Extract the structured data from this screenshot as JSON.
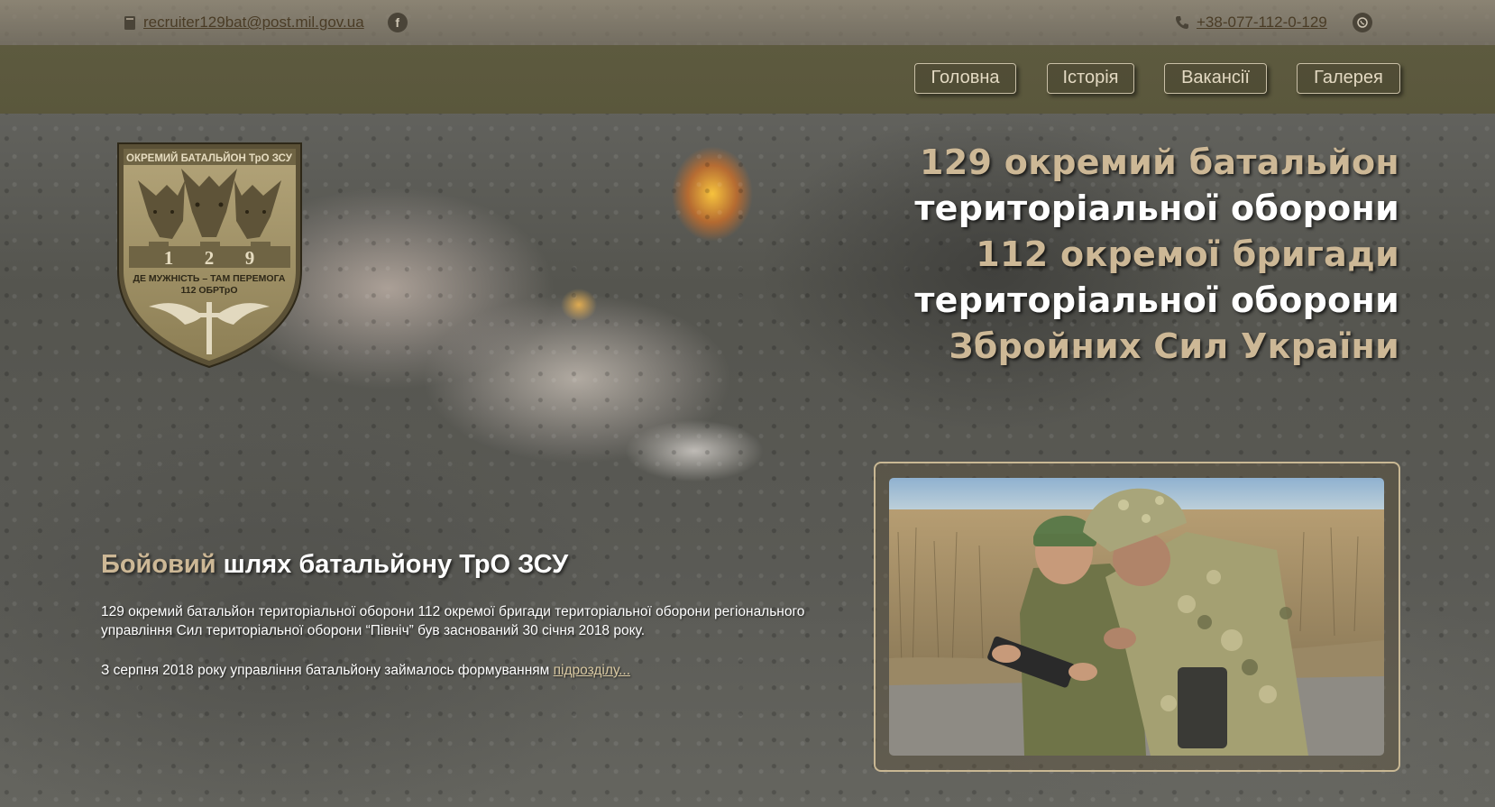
{
  "topbar": {
    "email": "recruiter129bat@post.mil.gov.ua",
    "phone": "+38-077-112-0-129",
    "book_icon": "book-icon",
    "facebook_icon": "facebook-icon",
    "phone_icon": "phone-icon",
    "whatsapp_icon": "whatsapp-icon"
  },
  "nav": {
    "items": [
      {
        "label": "Головна"
      },
      {
        "label": "Історія"
      },
      {
        "label": "Вакансії"
      },
      {
        "label": "Галерея"
      }
    ]
  },
  "emblem": {
    "top_text": "ОКРЕМИЙ БАТАЛЬЙОН ТрО ЗСУ",
    "digits": [
      "1",
      "2",
      "9"
    ],
    "motto": "ДЕ МУЖНІСТЬ – ТАМ ПЕРЕМОГА",
    "unit": "112 ОБРТрО"
  },
  "headline": {
    "line1": "129 окремий батальйон",
    "line2": "територіальної оборони",
    "line3": "112 окремої бригади",
    "line4": "територіальної оборони",
    "line5": "Збройних Сил України"
  },
  "section": {
    "title_gold": "Бойовий",
    "title_white": " шлях батальйону ТрО ЗСУ",
    "para1": "129 окремий батальйон територіальної оборони 112 окремої бригади територіальної оборони регіонального управління Сил територіальної оборони “Північ” був заснований 30 січня 2018 року.",
    "para2": "З серпня 2018 року управління батальйону займалось формуванням ",
    "link": "підрозділу..."
  },
  "colors": {
    "accent_gold": "#cdb896",
    "nav_bg": "#5d5a3f",
    "nav_border": "#c9bfa6"
  }
}
